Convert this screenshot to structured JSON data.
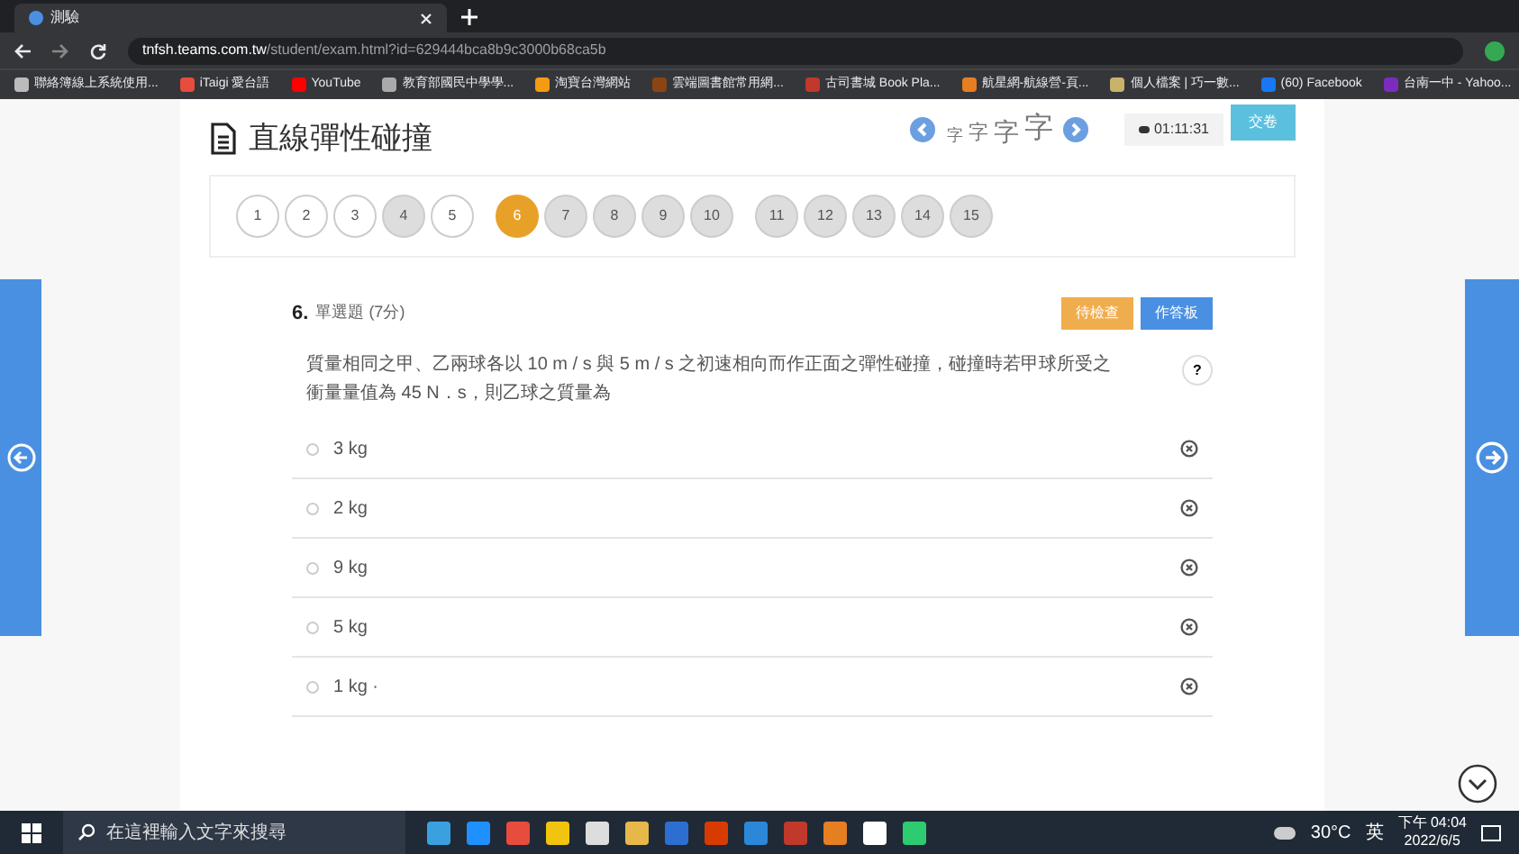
{
  "browser": {
    "tab_title": "測驗",
    "url_host": "tnfsh.teams.com.tw",
    "url_path": "/student/exam.html?id=629444bca8b9c3000b68ca5b",
    "bookmarks": [
      "聯絡簿線上系統使用...",
      "iTaigi 愛台語",
      "YouTube",
      "教育部國民中學學...",
      "淘寶台灣網站",
      "雲端圖書館常用網...",
      "古司書城 Book Pla...",
      "航星網-航線營-頁...",
      "個人檔案 | 巧一數...",
      "(60) Facebook",
      "台南一中 - Yahoo..."
    ]
  },
  "exam": {
    "title": "直線彈性碰撞",
    "font_sizes": [
      "字",
      "字",
      "字",
      "字"
    ],
    "timer": "01:11:31",
    "submit": "交卷",
    "question_groups": [
      [
        {
          "label": "1",
          "answered": true,
          "selected": false
        },
        {
          "label": "2",
          "answered": true,
          "selected": false
        },
        {
          "label": "3",
          "answered": true,
          "selected": false
        },
        {
          "label": "4",
          "answered": false,
          "selected": false
        },
        {
          "label": "5",
          "answered": true,
          "selected": false
        }
      ],
      [
        {
          "label": "6",
          "answered": false,
          "selected": true
        },
        {
          "label": "7",
          "answered": false,
          "selected": false
        },
        {
          "label": "8",
          "answered": false,
          "selected": false
        },
        {
          "label": "9",
          "answered": false,
          "selected": false
        },
        {
          "label": "10",
          "answered": false,
          "selected": false
        }
      ],
      [
        {
          "label": "11",
          "answered": false,
          "selected": false
        },
        {
          "label": "12",
          "answered": false,
          "selected": false
        },
        {
          "label": "13",
          "answered": false,
          "selected": false
        },
        {
          "label": "14",
          "answered": false,
          "selected": false
        },
        {
          "label": "15",
          "answered": false,
          "selected": false
        }
      ]
    ]
  },
  "question": {
    "number": "6.",
    "type": "單選題 (7分)",
    "buttons": [
      "待檢查",
      "作答板"
    ],
    "help": "?",
    "text": "質量相同之甲、乙兩球各以 10 m / s 與 5 m / s 之初速相向而作正面之彈性碰撞，碰撞時若甲球所受之衝量量值為 45 N．s，則乙球之質量為",
    "options": [
      {
        "label": "3 kg",
        "selected": false
      },
      {
        "label": "2 kg",
        "selected": false
      },
      {
        "label": "9 kg",
        "selected": false
      },
      {
        "label": "5 kg",
        "selected": false
      },
      {
        "label": "1 kg ·",
        "selected": false
      }
    ]
  },
  "taskbar": {
    "search": "在這裡輸入文字來搜尋",
    "temperature": "30°C",
    "ime": "英",
    "time": "下午 04:04",
    "date": "2022/6/5"
  }
}
